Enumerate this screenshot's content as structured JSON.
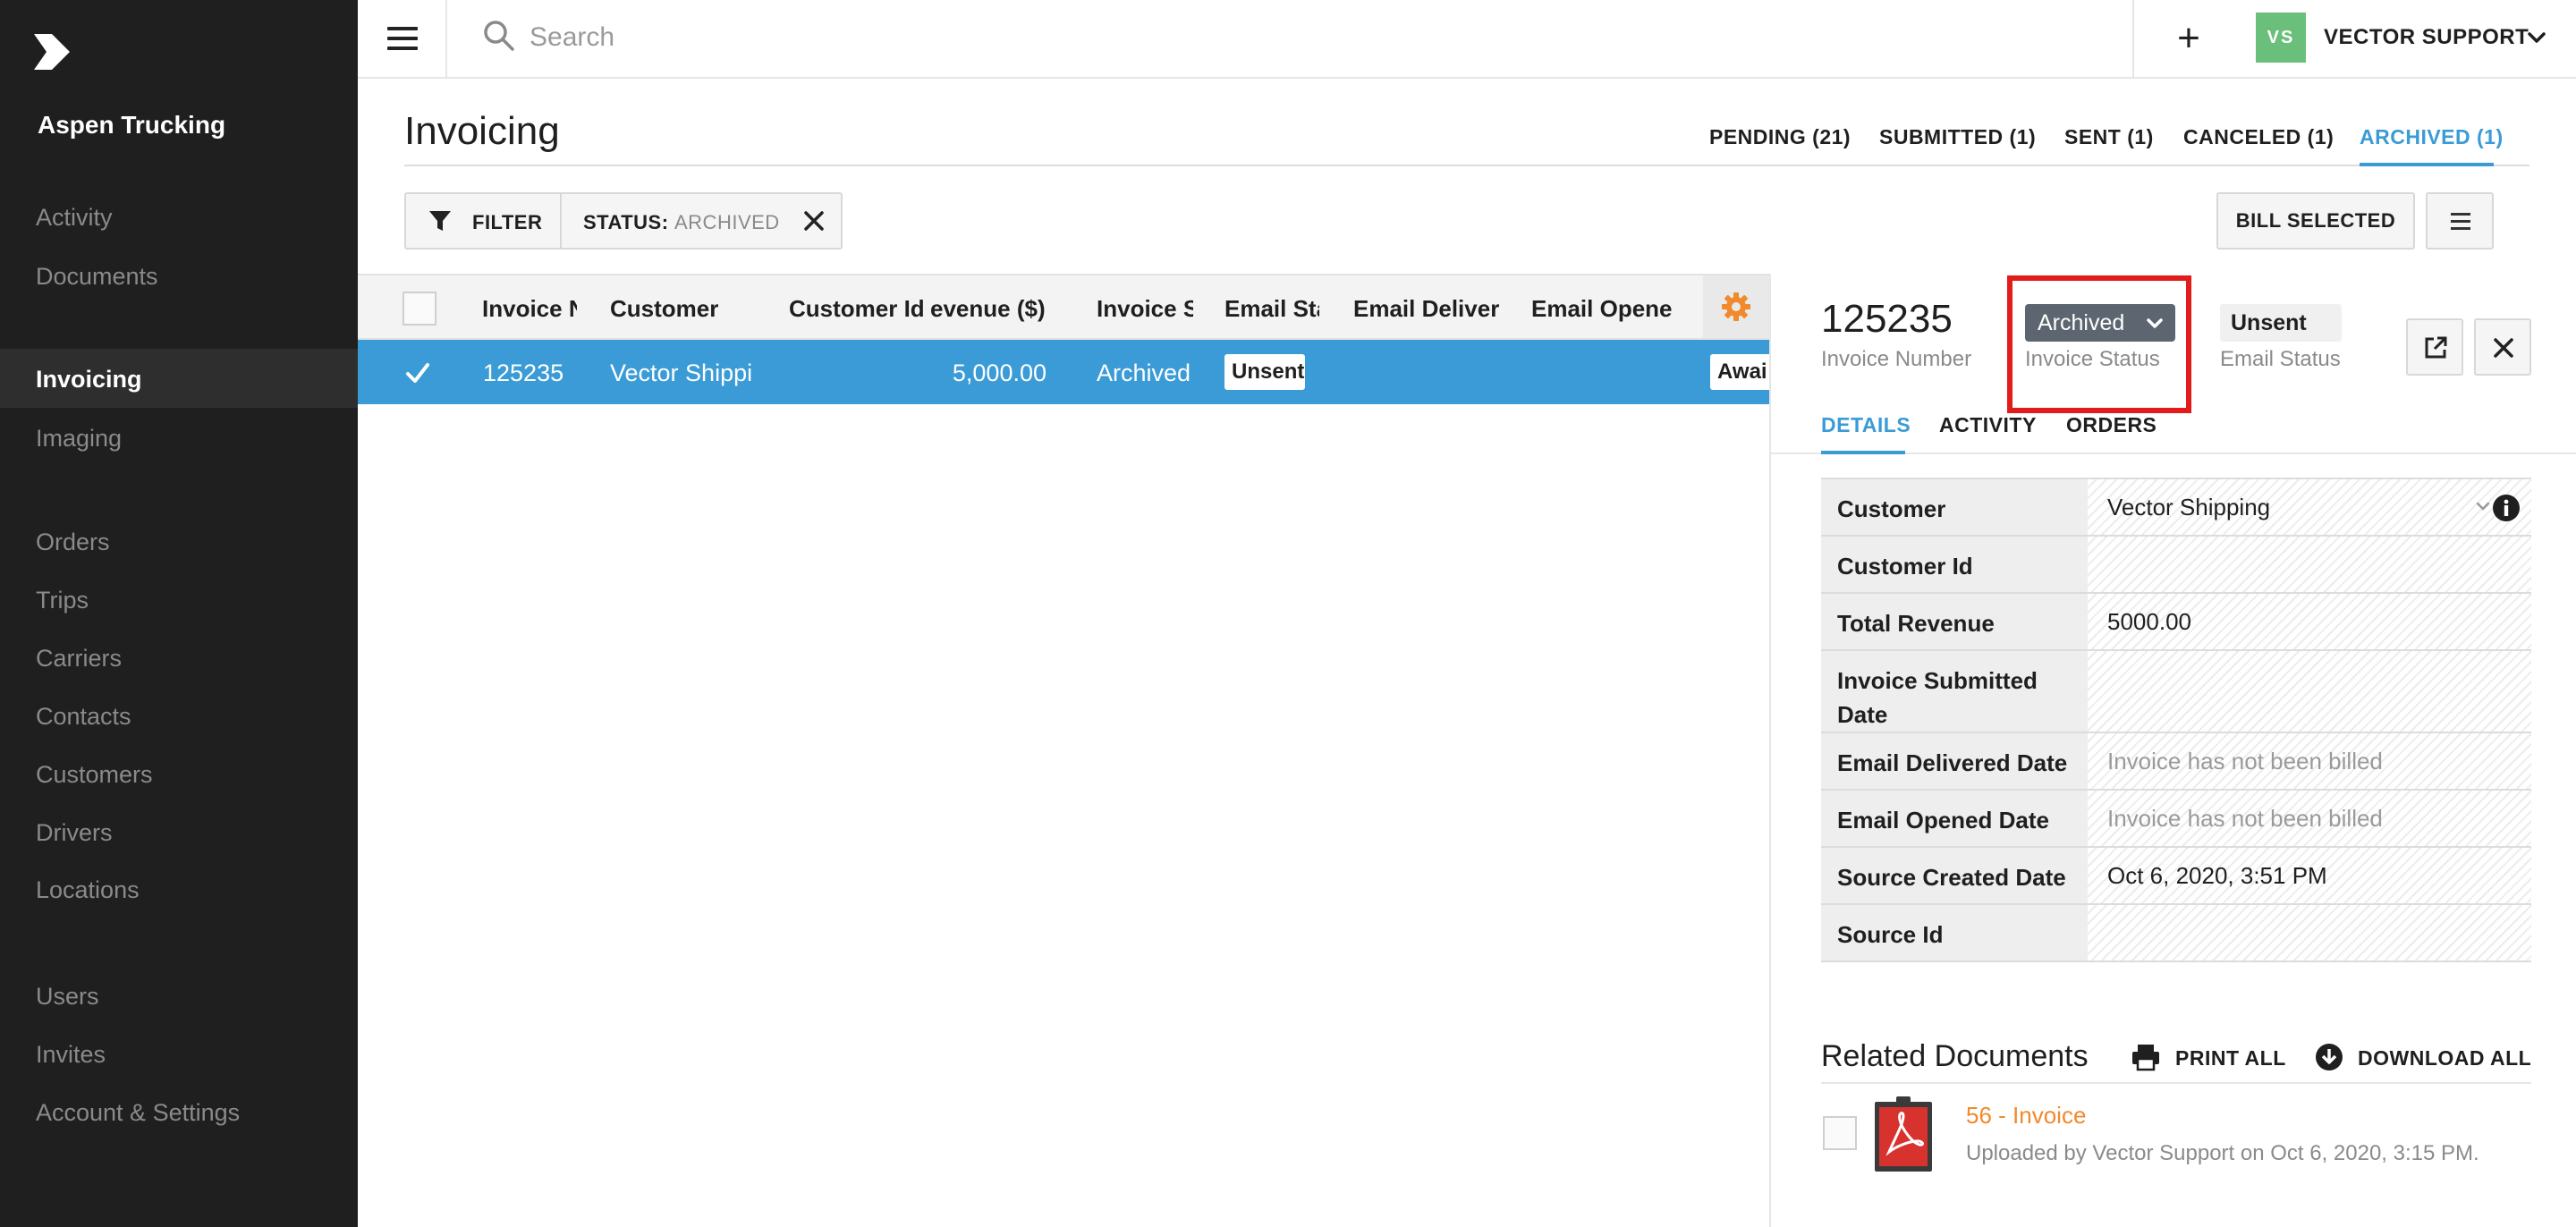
{
  "app": {
    "company": "Aspen Trucking"
  },
  "sidebar": {
    "items": [
      {
        "label": "Activity"
      },
      {
        "label": "Documents"
      },
      {
        "label": "Invoicing"
      },
      {
        "label": "Imaging"
      },
      {
        "label": "Orders"
      },
      {
        "label": "Trips"
      },
      {
        "label": "Carriers"
      },
      {
        "label": "Contacts"
      },
      {
        "label": "Customers"
      },
      {
        "label": "Drivers"
      },
      {
        "label": "Locations"
      },
      {
        "label": "Users"
      },
      {
        "label": "Invites"
      },
      {
        "label": "Account & Settings"
      }
    ],
    "active": "Invoicing"
  },
  "topbar": {
    "search_placeholder": "Search",
    "add_label": "+",
    "user_initials": "VS",
    "user_name": "VECTOR SUPPORT",
    "avatar_color": "#6abf7a"
  },
  "page": {
    "title": "Invoicing",
    "tabs": [
      {
        "label": "PENDING (21)"
      },
      {
        "label": "SUBMITTED (1)"
      },
      {
        "label": "SENT (1)"
      },
      {
        "label": "CANCELED (1)"
      },
      {
        "label": "ARCHIVED (1)"
      }
    ],
    "active_tab": "ARCHIVED (1)",
    "accent_color": "#3b9bd6"
  },
  "filters": {
    "filter_label": "FILTER",
    "status_key": "STATUS:",
    "status_value": "ARCHIVED"
  },
  "actions": {
    "bill_selected": "BILL SELECTED"
  },
  "table": {
    "columns": [
      "Invoice N",
      "Customer",
      "Customer Id",
      "evenue ($)",
      "Invoice S",
      "Email Sta",
      "Email Deliver",
      "Email Opene"
    ],
    "rows": [
      {
        "invoice_number": "125235",
        "customer": "Vector Shippi",
        "customer_id": "",
        "revenue": "5,000.00",
        "invoice_status": "Archived",
        "email_status": "Unsent",
        "email_delivered": "",
        "email_opened": "",
        "extra": "Awai",
        "selected": true
      }
    ]
  },
  "detail": {
    "invoice_number": "125235",
    "invoice_number_caption": "Invoice Number",
    "invoice_status": "Archived",
    "invoice_status_caption": "Invoice Status",
    "email_status": "Unsent",
    "email_status_caption": "Email Status",
    "tabs": [
      {
        "label": "DETAILS"
      },
      {
        "label": "ACTIVITY"
      },
      {
        "label": "ORDERS"
      }
    ],
    "active_tab": "DETAILS",
    "properties": [
      {
        "key": "Customer",
        "value": "Vector Shipping"
      },
      {
        "key": "Customer Id",
        "value": ""
      },
      {
        "key": "Total Revenue",
        "value": "5000.00"
      },
      {
        "key": "Invoice Submitted Date",
        "value": ""
      },
      {
        "key": "Email Delivered Date",
        "value": "Invoice has not been billed"
      },
      {
        "key": "Email Opened Date",
        "value": "Invoice has not been billed"
      },
      {
        "key": "Source Created Date",
        "value": "Oct 6, 2020, 3:51 PM"
      },
      {
        "key": "Source Id",
        "value": ""
      }
    ],
    "related": {
      "title": "Related Documents",
      "print_all": "PRINT ALL",
      "download_all": "DOWNLOAD ALL",
      "documents": [
        {
          "name": "56 - Invoice",
          "meta": "Uploaded by Vector Support on Oct 6, 2020, 3:15 PM."
        }
      ]
    },
    "highlight_color": "#e21b1b"
  }
}
